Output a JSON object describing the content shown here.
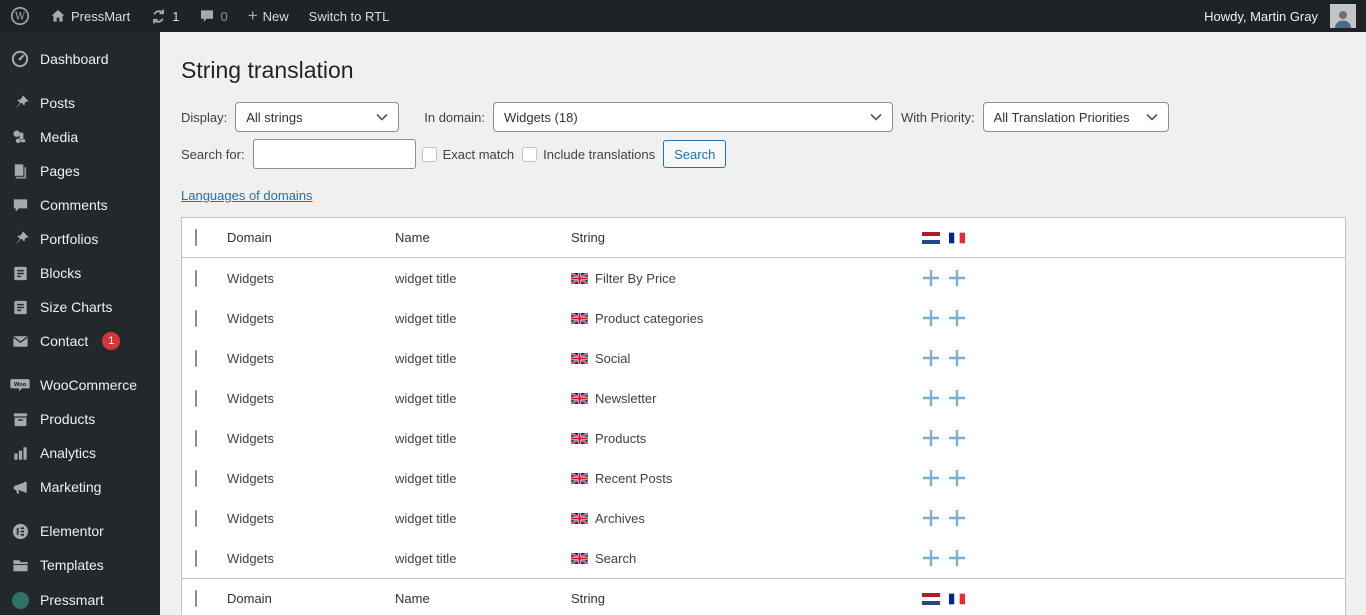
{
  "admin_bar": {
    "site_name": "PressMart",
    "updates_count": "1",
    "comments_count": "0",
    "plus_glyph": "+",
    "new_label": "New",
    "rtl_label": "Switch to RTL",
    "howdy": "Howdy, Martin Gray"
  },
  "sidebar": {
    "items": [
      {
        "label": "Dashboard"
      },
      {
        "label": "Posts"
      },
      {
        "label": "Media"
      },
      {
        "label": "Pages"
      },
      {
        "label": "Comments"
      },
      {
        "label": "Portfolios"
      },
      {
        "label": "Blocks"
      },
      {
        "label": "Size Charts"
      },
      {
        "label": "Contact",
        "badge": "1"
      },
      {
        "label": "WooCommerce"
      },
      {
        "label": "Products"
      },
      {
        "label": "Analytics"
      },
      {
        "label": "Marketing"
      },
      {
        "label": "Elementor"
      },
      {
        "label": "Templates"
      },
      {
        "label": "Pressmart"
      }
    ]
  },
  "main": {
    "title": "String translation",
    "filters": {
      "display_label": "Display:",
      "display_value": "All strings",
      "domain_label": "In domain:",
      "domain_value": "Widgets (18)",
      "priority_label": "With Priority:",
      "priority_value": "All Translation Priorities",
      "search_label": "Search for:",
      "exact_match_label": "Exact match",
      "include_translations_label": "Include translations",
      "search_button": "Search"
    },
    "languages_link": "Languages of domains",
    "table": {
      "headers": {
        "domain": "Domain",
        "name": "Name",
        "string": "String"
      },
      "languages": [
        "Dutch",
        "French"
      ],
      "source_language": "English",
      "rows": [
        {
          "domain": "Widgets",
          "name": "widget title",
          "string": "Filter By Price"
        },
        {
          "domain": "Widgets",
          "name": "widget title",
          "string": "Product categories"
        },
        {
          "domain": "Widgets",
          "name": "widget title",
          "string": "Social"
        },
        {
          "domain": "Widgets",
          "name": "widget title",
          "string": "Newsletter"
        },
        {
          "domain": "Widgets",
          "name": "widget title",
          "string": "Products"
        },
        {
          "domain": "Widgets",
          "name": "widget title",
          "string": "Recent Posts"
        },
        {
          "domain": "Widgets",
          "name": "widget title",
          "string": "Archives"
        },
        {
          "domain": "Widgets",
          "name": "widget title",
          "string": "Search"
        }
      ]
    }
  },
  "colors": {
    "accent": "#2271b1",
    "badge": "#d63638",
    "add_icon": "#7bafd4",
    "admin_bar_bg": "#1d2327",
    "sidebar_bg": "#23282d"
  }
}
